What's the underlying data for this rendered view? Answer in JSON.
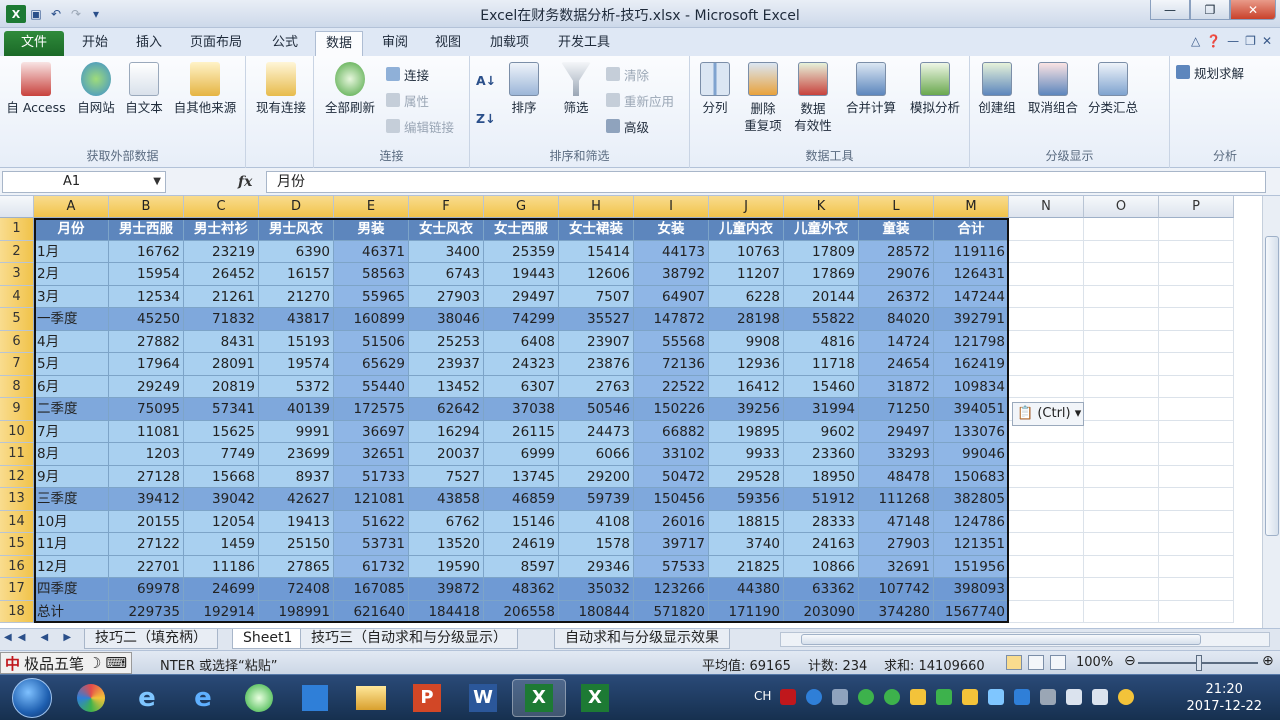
{
  "window": {
    "title": "Excel在财务数据分析-技巧.xlsx - Microsoft Excel",
    "controls": [
      "—",
      "❐",
      "✕"
    ]
  },
  "ribbon_tabs": [
    "文件",
    "开始",
    "插入",
    "页面布局",
    "公式",
    "数据",
    "审阅",
    "视图",
    "加载项",
    "开发工具"
  ],
  "ribbon": {
    "groups": {
      "external": "获取外部数据",
      "connections": "连接",
      "sort_filter": "排序和筛选",
      "data_tools": "数据工具",
      "outline": "分级显示",
      "analysis": "分析"
    },
    "buttons": {
      "from_access": "自 Access",
      "from_web": "自网站",
      "from_text": "自文本",
      "from_other": "自其他来源",
      "existing_conn": "现有连接",
      "refresh_all": "全部刷新",
      "connections": "连接",
      "properties": "属性",
      "edit_links": "编辑链接",
      "sort": "排序",
      "filter": "筛选",
      "clear": "清除",
      "reapply": "重新应用",
      "advanced": "高级",
      "text_to_columns": "分列",
      "remove_dup_1": "删除",
      "remove_dup_2": "重复项",
      "validation_1": "数据",
      "validation_2": "有效性",
      "consolidate": "合并计算",
      "what_if": "模拟分析",
      "group": "创建组",
      "ungroup": "取消组合",
      "subtotal": "分类汇总",
      "solver": "规划求解"
    }
  },
  "formula_bar": {
    "name_box": "A1",
    "fx": "fx",
    "content": "月份"
  },
  "grid": {
    "columns": [
      "A",
      "B",
      "C",
      "D",
      "E",
      "F",
      "G",
      "H",
      "I",
      "J",
      "K",
      "L",
      "M",
      "N",
      "O",
      "P"
    ],
    "rows": [
      "1",
      "2",
      "3",
      "4",
      "5",
      "6",
      "7",
      "8",
      "9",
      "10",
      "11",
      "12",
      "13",
      "14",
      "15",
      "16",
      "17",
      "18"
    ],
    "header": [
      "月份",
      "男士西服",
      "男士衬衫",
      "男士风衣",
      "男装",
      "女士风衣",
      "女士西服",
      "女士裙装",
      "女装",
      "儿童内衣",
      "儿童外衣",
      "童装",
      "合计"
    ],
    "data": [
      [
        "1月",
        "16762",
        "23219",
        "6390",
        "46371",
        "3400",
        "25359",
        "15414",
        "44173",
        "10763",
        "17809",
        "28572",
        "119116"
      ],
      [
        "2月",
        "15954",
        "26452",
        "16157",
        "58563",
        "6743",
        "19443",
        "12606",
        "38792",
        "11207",
        "17869",
        "29076",
        "126431"
      ],
      [
        "3月",
        "12534",
        "21261",
        "21270",
        "55965",
        "27903",
        "29497",
        "7507",
        "64907",
        "6228",
        "20144",
        "26372",
        "147244"
      ],
      [
        "一季度",
        "45250",
        "71832",
        "43817",
        "160899",
        "38046",
        "74299",
        "35527",
        "147872",
        "28198",
        "55822",
        "84020",
        "392791"
      ],
      [
        "4月",
        "27882",
        "8431",
        "15193",
        "51506",
        "25253",
        "6408",
        "23907",
        "55568",
        "9908",
        "4816",
        "14724",
        "121798"
      ],
      [
        "5月",
        "17964",
        "28091",
        "19574",
        "65629",
        "23937",
        "24323",
        "23876",
        "72136",
        "12936",
        "11718",
        "24654",
        "162419"
      ],
      [
        "6月",
        "29249",
        "20819",
        "5372",
        "55440",
        "13452",
        "6307",
        "2763",
        "22522",
        "16412",
        "15460",
        "31872",
        "109834"
      ],
      [
        "二季度",
        "75095",
        "57341",
        "40139",
        "172575",
        "62642",
        "37038",
        "50546",
        "150226",
        "39256",
        "31994",
        "71250",
        "394051"
      ],
      [
        "7月",
        "11081",
        "15625",
        "9991",
        "36697",
        "16294",
        "26115",
        "24473",
        "66882",
        "19895",
        "9602",
        "29497",
        "133076"
      ],
      [
        "8月",
        "1203",
        "7749",
        "23699",
        "32651",
        "20037",
        "6999",
        "6066",
        "33102",
        "9933",
        "23360",
        "33293",
        "99046"
      ],
      [
        "9月",
        "27128",
        "15668",
        "8937",
        "51733",
        "7527",
        "13745",
        "29200",
        "50472",
        "29528",
        "18950",
        "48478",
        "150683"
      ],
      [
        "三季度",
        "39412",
        "39042",
        "42627",
        "121081",
        "43858",
        "46859",
        "59739",
        "150456",
        "59356",
        "51912",
        "111268",
        "382805"
      ],
      [
        "10月",
        "20155",
        "12054",
        "19413",
        "51622",
        "6762",
        "15146",
        "4108",
        "26016",
        "18815",
        "28333",
        "47148",
        "124786"
      ],
      [
        "11月",
        "27122",
        "1459",
        "25150",
        "53731",
        "13520",
        "24619",
        "1578",
        "39717",
        "3740",
        "24163",
        "27903",
        "121351"
      ],
      [
        "12月",
        "22701",
        "11186",
        "27865",
        "61732",
        "19590",
        "8597",
        "29346",
        "57533",
        "21825",
        "10866",
        "32691",
        "151956"
      ],
      [
        "四季度",
        "69978",
        "24699",
        "72408",
        "167085",
        "39872",
        "48362",
        "35032",
        "123266",
        "44380",
        "63362",
        "107742",
        "398093"
      ],
      [
        "总计",
        "229735",
        "192914",
        "198991",
        "621640",
        "184418",
        "206558",
        "180844",
        "571820",
        "171190",
        "203090",
        "374280",
        "1567740"
      ]
    ]
  },
  "paste_options": "(Ctrl)",
  "sheet_tabs": [
    "技巧二（填充柄）",
    "Sheet1",
    "技巧三（自动求和与分级显示）",
    "自动求和与分级显示效果"
  ],
  "sheet_nav": "◀◀ ◀ ▶ ▶▶",
  "status": {
    "ime": "极品五笔",
    "message": "NTER 或选择“粘贴”",
    "average": "平均值: 69165",
    "count": "计数: 234",
    "sum": "求和: 14109660",
    "zoom": "100%"
  },
  "taskbar": {
    "apps": [
      "IE",
      "IE",
      "360",
      "Win",
      "Files",
      "PPT",
      "Word",
      "Excel",
      "Excel"
    ],
    "tray_lang": "CH",
    "time": "21:20",
    "date": "2017-12-22"
  },
  "colors": {
    "header_fill": "#5d86bd",
    "month_row": "#a9d0f0",
    "quarter_row": "#7fa8dc",
    "footer_row": "#6f9ad4",
    "selection_header": "#f1c34a"
  }
}
